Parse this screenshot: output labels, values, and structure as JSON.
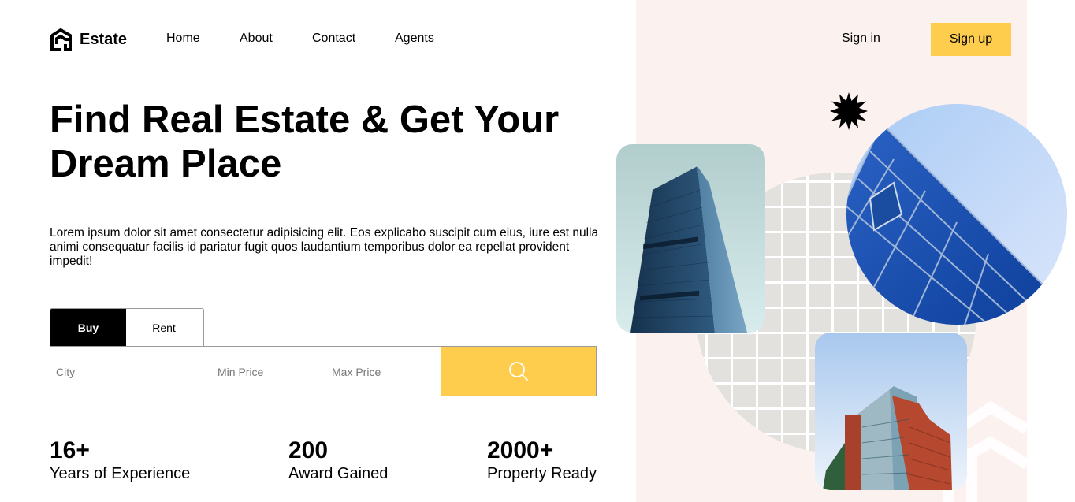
{
  "brand": {
    "name": "Estate"
  },
  "nav": {
    "links": [
      "Home",
      "About",
      "Contact",
      "Agents"
    ],
    "signin": "Sign in",
    "signup": "Sign up"
  },
  "hero": {
    "title": "Find Real Estate & Get Your Dream Place",
    "description": "Lorem ipsum dolor sit amet consectetur adipisicing elit. Eos explicabo suscipit cum eius, iure est nulla animi consequatur facilis id pariatur fugit quos laudantium temporibus dolor ea repellat provident impedit!"
  },
  "search": {
    "tabs": [
      {
        "label": "Buy",
        "active": true
      },
      {
        "label": "Rent",
        "active": false
      }
    ],
    "city_placeholder": "City",
    "min_price_placeholder": "Min Price",
    "max_price_placeholder": "Max Price",
    "icon": "search-icon"
  },
  "stats": [
    {
      "value": "16+",
      "label": "Years of Experience"
    },
    {
      "value": "200",
      "label": "Award Gained"
    },
    {
      "value": "2000+",
      "label": "Property Ready"
    }
  ],
  "colors": {
    "accent": "#ffcd4d",
    "panel_bg": "#fbf1ef",
    "tab_active": "#000000",
    "grid_circle": "#e3e1dd"
  }
}
